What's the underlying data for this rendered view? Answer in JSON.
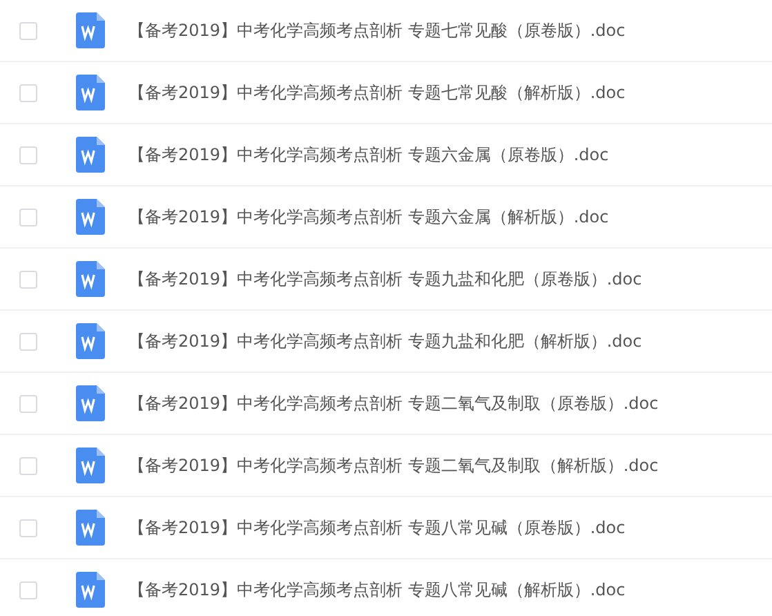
{
  "files": [
    {
      "name": "【备考2019】中考化学高频考点剖析 专题七常见酸（原卷版）.doc",
      "checked": false
    },
    {
      "name": "【备考2019】中考化学高频考点剖析 专题七常见酸（解析版）.doc",
      "checked": false
    },
    {
      "name": "【备考2019】中考化学高频考点剖析 专题六金属（原卷版）.doc",
      "checked": false
    },
    {
      "name": "【备考2019】中考化学高频考点剖析 专题六金属（解析版）.doc",
      "checked": false
    },
    {
      "name": "【备考2019】中考化学高频考点剖析 专题九盐和化肥（原卷版）.doc",
      "checked": false
    },
    {
      "name": "【备考2019】中考化学高频考点剖析 专题九盐和化肥（解析版）.doc",
      "checked": false
    },
    {
      "name": "【备考2019】中考化学高频考点剖析 专题二氧气及制取（原卷版）.doc",
      "checked": false
    },
    {
      "name": "【备考2019】中考化学高频考点剖析 专题二氧气及制取（解析版）.doc",
      "checked": false
    },
    {
      "name": "【备考2019】中考化学高频考点剖析 专题八常见碱（原卷版）.doc",
      "checked": false
    },
    {
      "name": "【备考2019】中考化学高频考点剖析 专题八常见碱（解析版）.doc",
      "checked": false
    }
  ]
}
